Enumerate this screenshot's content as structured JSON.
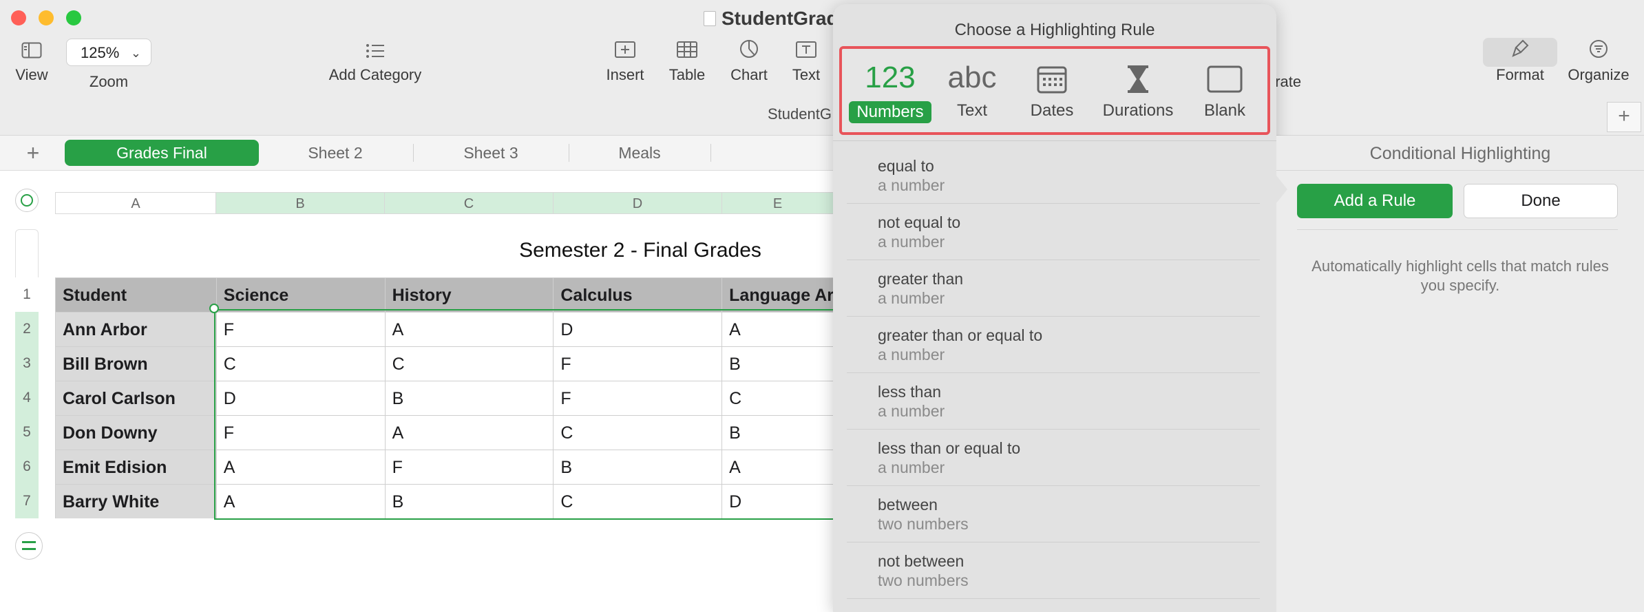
{
  "window": {
    "title": "StudentGrades"
  },
  "toolbar": {
    "view": "View",
    "zoom_value": "125%",
    "zoom": "Zoom",
    "add_category": "Add Category",
    "insert": "Insert",
    "table": "Table",
    "chart": "Chart",
    "text": "Text",
    "collaborate_partial": "orate",
    "format": "Format",
    "organize": "Organize",
    "doc_name_partial": "StudentG"
  },
  "sheets": {
    "add": "+",
    "tabs": [
      "Grades Final",
      "Sheet 2",
      "Sheet 3",
      "Meals"
    ],
    "active_index": 0,
    "add_sidebar": "+"
  },
  "table": {
    "title": "Semester 2 - Final Grades",
    "col_letters": [
      "A",
      "B",
      "C",
      "D",
      "E"
    ],
    "row_numbers": [
      "1",
      "2",
      "3",
      "4",
      "5",
      "6",
      "7"
    ],
    "headers": [
      "Student",
      "Science",
      "History",
      "Calculus",
      "Language Ar"
    ],
    "rows": [
      [
        "Ann Arbor",
        "F",
        "A",
        "D",
        "A"
      ],
      [
        "Bill Brown",
        "C",
        "C",
        "F",
        "B"
      ],
      [
        "Carol Carlson",
        "D",
        "B",
        "F",
        "C"
      ],
      [
        "Don Downy",
        "F",
        "A",
        "C",
        "B"
      ],
      [
        "Emit Edision",
        "A",
        "F",
        "B",
        "A"
      ],
      [
        "Barry White",
        "A",
        "B",
        "C",
        "D"
      ]
    ]
  },
  "popover": {
    "title": "Choose a Highlighting Rule",
    "types": [
      {
        "glyph": "123",
        "label": "Numbers"
      },
      {
        "glyph": "abc",
        "label": "Text"
      },
      {
        "glyph": "calendar-icon",
        "label": "Dates"
      },
      {
        "glyph": "hourglass-icon",
        "label": "Durations"
      },
      {
        "glyph": "blank-rect-icon",
        "label": "Blank"
      }
    ],
    "selected_type": 0,
    "rules": [
      {
        "name": "equal to",
        "arg": "a number"
      },
      {
        "name": "not equal to",
        "arg": "a number"
      },
      {
        "name": "greater than",
        "arg": "a number"
      },
      {
        "name": "greater than or equal to",
        "arg": "a number"
      },
      {
        "name": "less than",
        "arg": "a number"
      },
      {
        "name": "less than or equal to",
        "arg": "a number"
      },
      {
        "name": "between",
        "arg": "two numbers"
      },
      {
        "name": "not between",
        "arg": "two numbers"
      }
    ]
  },
  "sidebar": {
    "title": "Conditional Highlighting",
    "add_rule": "Add a Rule",
    "done": "Done",
    "hint": "Automatically highlight cells that match rules you specify."
  },
  "colors": {
    "accent_green": "#28a046",
    "popover_highlight": "#e8545a",
    "close": "#ff5f57",
    "minimize": "#febc2e",
    "zoom": "#28c840"
  }
}
